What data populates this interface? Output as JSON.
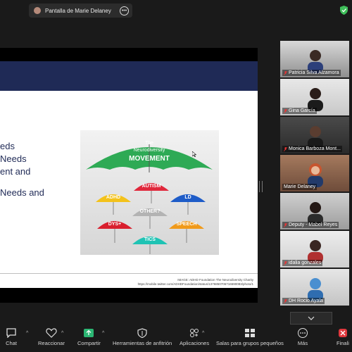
{
  "share_bar": {
    "title": "Pantalla de Marie Delaney",
    "more_icon": "ellipsis-circle-icon",
    "secure_icon": "shield-check-icon"
  },
  "slide": {
    "bullets": [
      "eds",
      "Needs",
      "ent and",
      "Needs and"
    ],
    "caption_line1": "IMAGE: ADHD Foundation The Neurodiversity Charity",
    "caption_line2": "https://mobile.twitter.com/ADHDFoundation/status/1376850706716590083/photo/1",
    "umbrella": {
      "title_line1": "The",
      "title_line2": "Neurodiversity",
      "title_line3": "MOVEMENT",
      "small": [
        "ADHD",
        "AUTISM",
        "LD",
        "DYS+",
        "OTHER?",
        "SPEECH",
        "TICS"
      ]
    }
  },
  "participants": [
    {
      "name": "Patricia Silva Alzamora",
      "muted": true
    },
    {
      "name": "Gina García",
      "muted": true
    },
    {
      "name": "Monica Barboza Mont...",
      "muted": true
    },
    {
      "name": "Marie Delaney",
      "muted": false
    },
    {
      "name": "Deputy - Mabel Reyes",
      "muted": true
    },
    {
      "name": "idalia gonzales",
      "muted": true
    },
    {
      "name": "DH Rocio Ayala",
      "muted": true
    }
  ],
  "toolbar": {
    "chat": "Chat",
    "reactions": "Reaccionar",
    "share": "Compartir",
    "host_tools": "Herramientas de anfitrión",
    "apps": "Aplicaciones",
    "breakout": "Salas para grupos pequeños",
    "more": "Más",
    "end": "Finali"
  },
  "colors": {
    "accent_green": "#35c58a",
    "slide_header": "#1f2a56",
    "end_red": "#e0383e"
  }
}
